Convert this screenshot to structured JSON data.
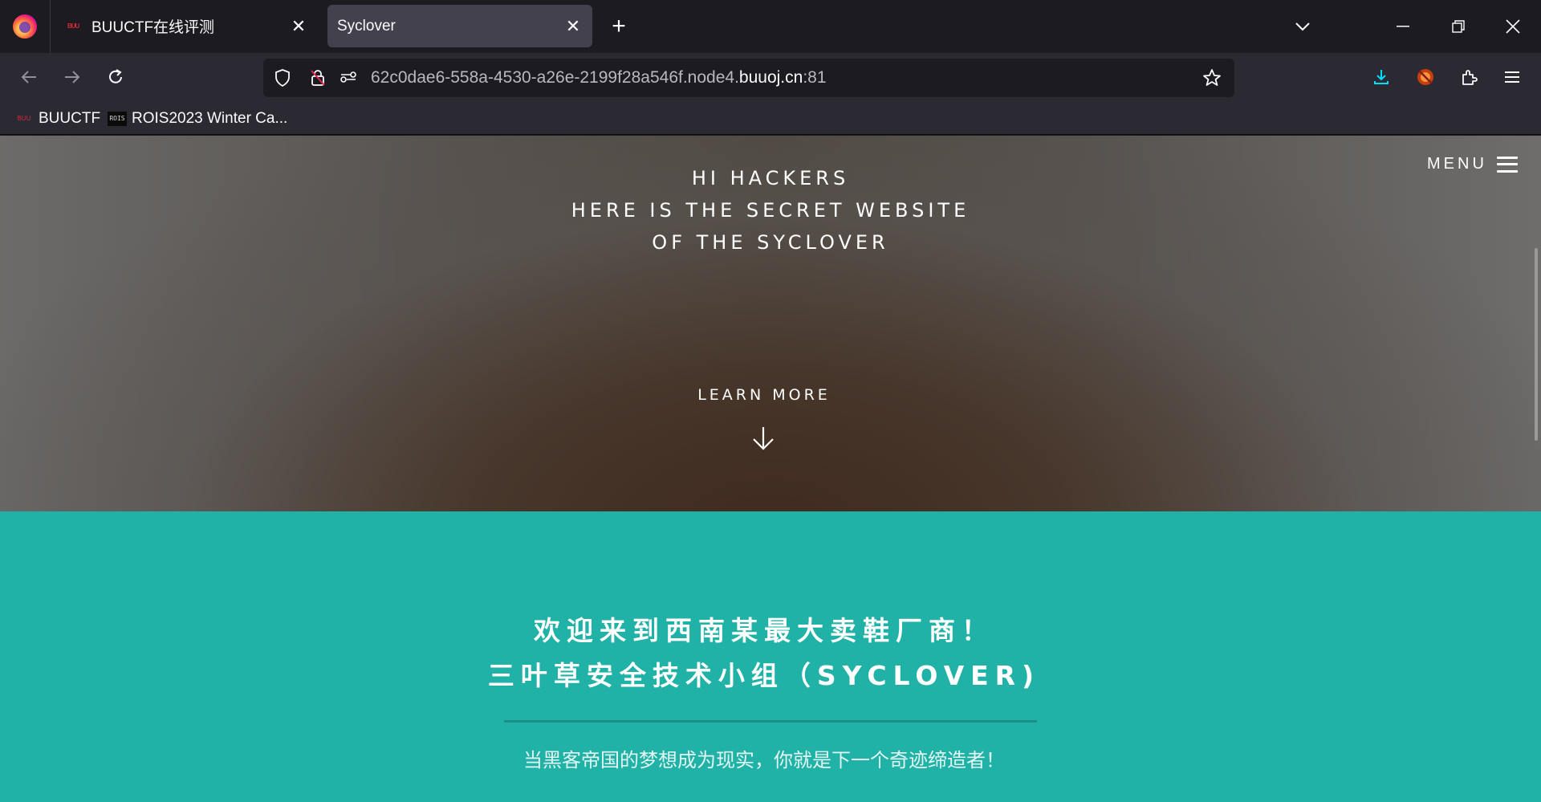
{
  "browser": {
    "tabs": [
      {
        "title": "BUUCTF在线评测",
        "favicon_text": "BUU",
        "active": false
      },
      {
        "title": "Syclover",
        "active": true
      }
    ],
    "url": {
      "prefix": "62c0dae6-558a-4530-a26e-2199f28a546f.node4.",
      "domain": "buuoj.cn",
      "port": ":81"
    },
    "bookmarks": [
      {
        "label": "BUUCTF",
        "icon_text": "BUU"
      },
      {
        "label": "ROIS2023 Winter Ca...",
        "icon_text": "ROIS"
      }
    ],
    "accent_color": "#00ddff"
  },
  "page": {
    "menu_label": "MENU",
    "hero_lines": [
      "HI HACKERS",
      "HERE IS THE SECRET WEBSITE",
      "OF THE SYCLOVER"
    ],
    "learn_more": "LEARN MORE",
    "section": {
      "title_line1": "欢迎来到西南某最大卖鞋厂商！",
      "title_line2": "三叶草安全技术小组（SYCLOVER)",
      "subtitle": "当黑客帝国的梦想成为现实，你就是下一个奇迹缔造者！",
      "bg_color": "#20b2a6"
    }
  }
}
